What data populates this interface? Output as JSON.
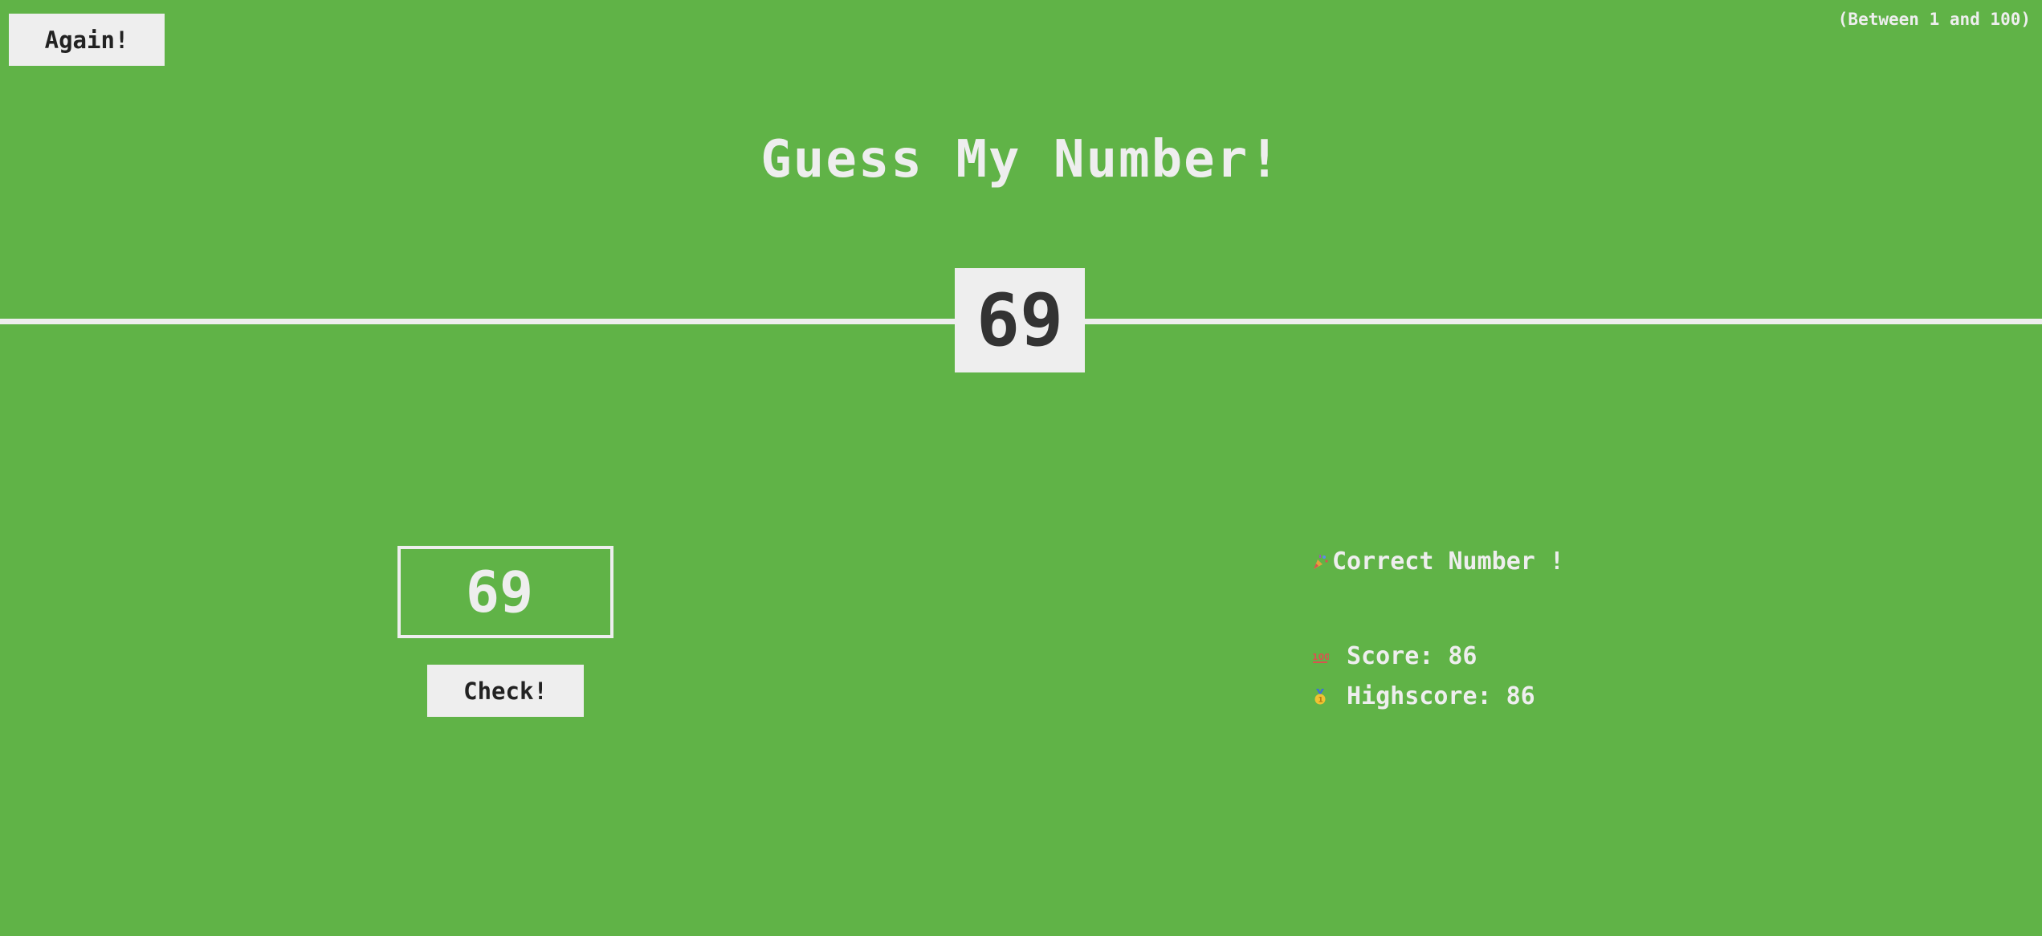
{
  "header": {
    "again_label": "Again!",
    "range_hint": "(Between 1 and 100)",
    "title": "Guess My Number!"
  },
  "secret": {
    "number": "69"
  },
  "left": {
    "guess_value": "69",
    "check_label": "Check!"
  },
  "right": {
    "message": "Correct Number !",
    "message_icon": "party-popper-icon",
    "score_label": "Score:",
    "score_value": "86",
    "score_icon": "hundred-points-icon",
    "highscore_label": "Highscore:",
    "highscore_value": "86",
    "highscore_icon": "medal-icon"
  },
  "colors": {
    "background": "#60b347",
    "foreground": "#eeeeee",
    "dark_text": "#333333"
  }
}
